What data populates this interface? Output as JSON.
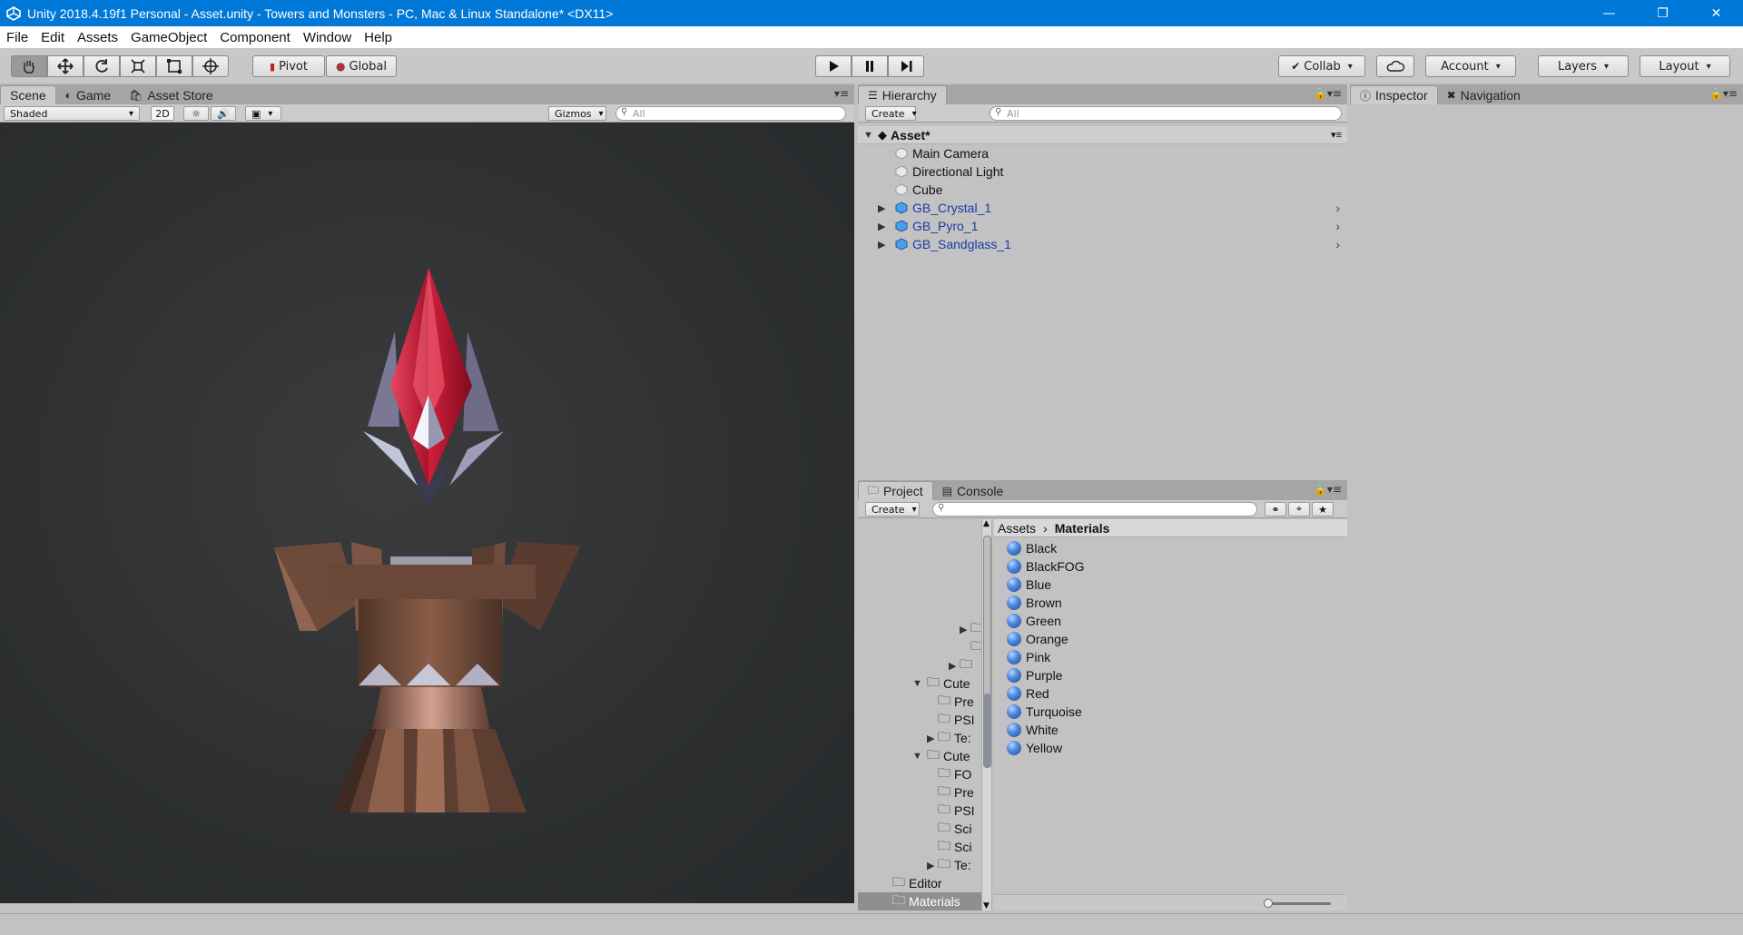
{
  "window": {
    "title": "Unity 2018.4.19f1 Personal - Asset.unity - Towers and Monsters - PC, Mac & Linux Standalone* <DX11>",
    "controls": {
      "minimize": "—",
      "maximize": "❐",
      "close": "✕"
    }
  },
  "menu": [
    "File",
    "Edit",
    "Assets",
    "GameObject",
    "Component",
    "Window",
    "Help"
  ],
  "toolbar": {
    "tools": [
      "hand-tool",
      "move-tool",
      "rotate-tool",
      "scale-tool",
      "rect-tool",
      "transform-tool"
    ],
    "pivot_label": "Pivot",
    "global_label": "Global",
    "collab_label": "Collab",
    "account_label": "Account",
    "layers_label": "Layers",
    "layout_label": "Layout"
  },
  "scene_panel": {
    "tabs": [
      "Scene",
      "Game",
      "Asset Store"
    ],
    "shading_mode": "Shaded",
    "mode_2d": "2D",
    "gizmos_label": "Gizmos",
    "search_placeholder": "All"
  },
  "hierarchy": {
    "tab": "Hierarchy",
    "create_label": "Create",
    "search_placeholder": "All",
    "scene_name": "Asset*",
    "items": [
      {
        "label": "Main Camera",
        "prefab": false
      },
      {
        "label": "Directional Light",
        "prefab": false
      },
      {
        "label": "Cube",
        "prefab": false
      },
      {
        "label": "GB_Crystal_1",
        "prefab": true
      },
      {
        "label": "GB_Pyro_1",
        "prefab": true
      },
      {
        "label": "GB_Sandglass_1",
        "prefab": true
      }
    ]
  },
  "inspector": {
    "tabs": [
      "Inspector",
      "Navigation"
    ]
  },
  "project": {
    "tabs": [
      "Project",
      "Console"
    ],
    "create_label": "Create",
    "breadcrumb": [
      "Assets",
      "Materials"
    ],
    "folders": [
      {
        "label": "Cute",
        "indent": 1,
        "expanded": true
      },
      {
        "label": "Pre",
        "indent": 2
      },
      {
        "label": "PSI",
        "indent": 2
      },
      {
        "label": "Te:",
        "indent": 2,
        "collapsed": true
      },
      {
        "label": "Cute",
        "indent": 1,
        "expanded": true
      },
      {
        "label": "FO",
        "indent": 2
      },
      {
        "label": "Pre",
        "indent": 2
      },
      {
        "label": "PSI",
        "indent": 2
      },
      {
        "label": "Sci",
        "indent": 2
      },
      {
        "label": "Sci",
        "indent": 2
      },
      {
        "label": "Te:",
        "indent": 2,
        "collapsed": true
      },
      {
        "label": "Editor",
        "indent": 0
      },
      {
        "label": "Materials",
        "indent": 0,
        "selected": true
      }
    ],
    "materials": [
      "Black",
      "BlackFOG",
      "Blue",
      "Brown",
      "Green",
      "Orange",
      "Pink",
      "Purple",
      "Red",
      "Turquoise",
      "White",
      "Yellow"
    ]
  }
}
